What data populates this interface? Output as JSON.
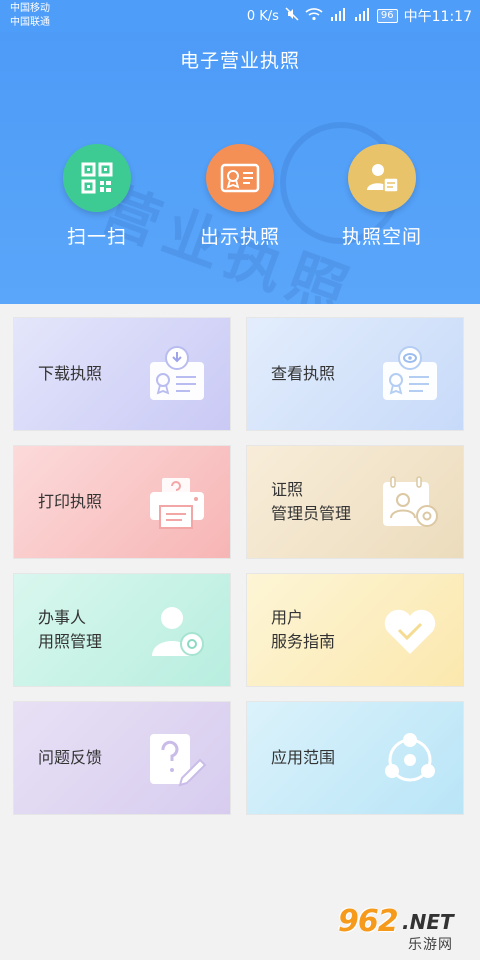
{
  "status_bar": {
    "carrier1": "中国移动",
    "carrier2": "中国联通",
    "speed": "0 K/s",
    "battery": "96",
    "time": "中午11:17",
    "icons": [
      "mute-icon",
      "wifi-icon",
      "signal-2g-icon",
      "signal-4g-icon"
    ]
  },
  "header": {
    "title": "电子营业执照",
    "watermark_text": "营业执照",
    "quick_actions": [
      {
        "label": "扫一扫",
        "icon": "qr-code-icon",
        "color": "#3ecb93"
      },
      {
        "label": "出示执照",
        "icon": "license-card-icon",
        "color": "#f48f55"
      },
      {
        "label": "执照空间",
        "icon": "license-space-icon",
        "color": "#e8c36a"
      }
    ]
  },
  "grid": [
    {
      "lines": [
        "下载执照"
      ],
      "icon": "download-license-icon"
    },
    {
      "lines": [
        "查看执照"
      ],
      "icon": "view-license-icon"
    },
    {
      "lines": [
        "打印执照"
      ],
      "icon": "printer-icon"
    },
    {
      "lines": [
        "证照",
        "管理员管理"
      ],
      "icon": "admin-manage-icon"
    },
    {
      "lines": [
        "办事人",
        "用照管理"
      ],
      "icon": "agent-manage-icon"
    },
    {
      "lines": [
        "用户",
        "服务指南"
      ],
      "icon": "heart-icon"
    },
    {
      "lines": [
        "问题反馈"
      ],
      "icon": "feedback-icon"
    },
    {
      "lines": [
        "应用范围"
      ],
      "icon": "scope-icon"
    }
  ],
  "watermark_logo": {
    "number": "962",
    "suffix": ".NET",
    "subtitle": "乐游网"
  },
  "colors": {
    "header_blue": "#4e9df8"
  }
}
